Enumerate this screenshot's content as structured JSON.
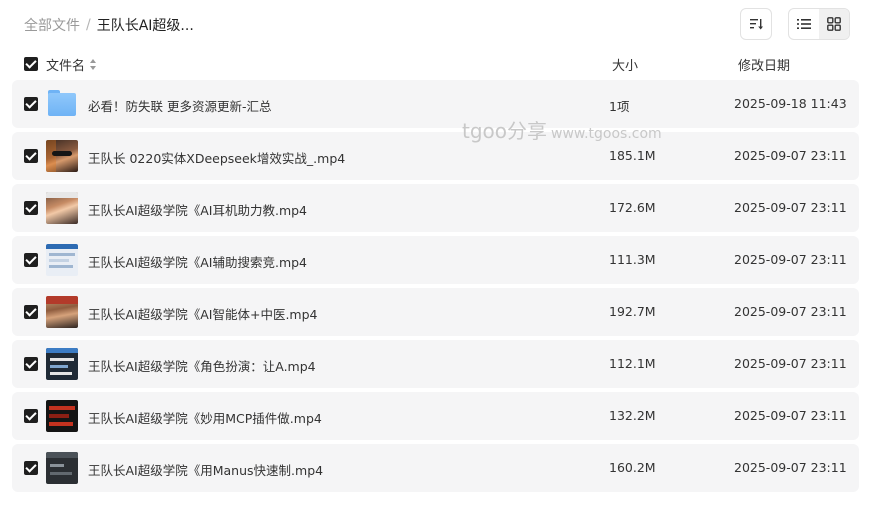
{
  "breadcrumb": {
    "root": "全部文件",
    "separator": "/",
    "current": "王队长AI超级..."
  },
  "header": {
    "name": "文件名",
    "size": "大小",
    "date": "修改日期"
  },
  "watermark": {
    "text": "tgoo分享",
    "url": "www.tgoos.com"
  },
  "files": [
    {
      "name": "必看！防失联 更多资源更新-汇总",
      "size": "1项",
      "date": "2025-09-18 11:43",
      "thumb": "folder-icon"
    },
    {
      "name": "王队长 0220实体XDeepseek增效实战_.mp4",
      "size": "185.1M",
      "date": "2025-09-07 23:11",
      "thumb": "video-thumbnail"
    },
    {
      "name": "王队长AI超级学院《AI耳机助力教.mp4",
      "size": "172.6M",
      "date": "2025-09-07 23:11",
      "thumb": "video-thumbnail"
    },
    {
      "name": "王队长AI超级学院《AI辅助搜索竞.mp4",
      "size": "111.3M",
      "date": "2025-09-07 23:11",
      "thumb": "video-thumbnail"
    },
    {
      "name": "王队长AI超级学院《AI智能体+中医.mp4",
      "size": "192.7M",
      "date": "2025-09-07 23:11",
      "thumb": "video-thumbnail"
    },
    {
      "name": "王队长AI超级学院《角色扮演：让A.mp4",
      "size": "112.1M",
      "date": "2025-09-07 23:11",
      "thumb": "video-thumbnail"
    },
    {
      "name": "王队长AI超级学院《妙用MCP插件做.mp4",
      "size": "132.2M",
      "date": "2025-09-07 23:11",
      "thumb": "video-thumbnail"
    },
    {
      "name": "王队长AI超级学院《用Manus快速制.mp4",
      "size": "160.2M",
      "date": "2025-09-07 23:11",
      "thumb": "video-thumbnail"
    }
  ],
  "colors": {
    "row_bg": "#f5f5f6",
    "checkbox": "#1f1f1f",
    "folder": "#6fb3f5"
  }
}
